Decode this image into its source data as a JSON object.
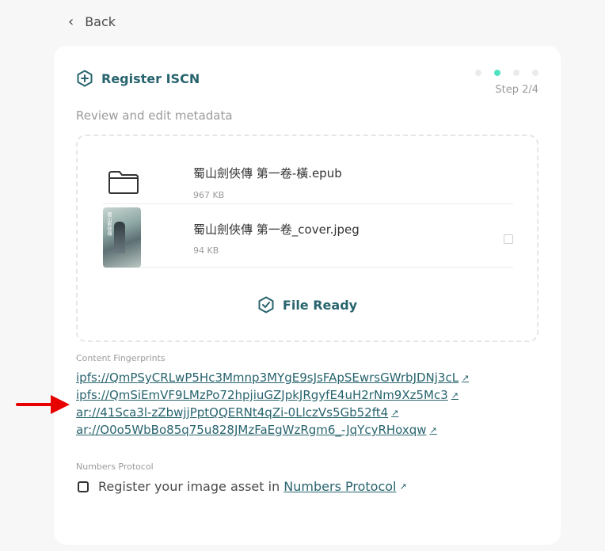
{
  "nav": {
    "back_label": "Back"
  },
  "header": {
    "title": "Register ISCN",
    "step_label": "Step 2/4",
    "steps_total": 4,
    "step_current": 2
  },
  "subtitle": "Review and edit metadata",
  "files": [
    {
      "name": "蜀山劍俠傳 第一卷-橫.epub",
      "size": "967 KB",
      "icon": "folder-icon"
    },
    {
      "name": "蜀山劍俠傳 第一卷_cover.jpeg",
      "size": "94 KB",
      "icon": "image-thumbnail"
    }
  ],
  "file_ready_label": "File Ready",
  "fingerprints": {
    "label": "Content Fingerprints",
    "links": [
      "ipfs://QmPSyCRLwP5Hc3Mmnp3MYgE9sJsFApSEwrsGWrbJDNj3cL",
      "ipfs://QmSiEmVF9LMzPo72hpjiuGZJpkJRgyfE4uH2rNm9Xz5Mc3",
      "ar://41Sca3l-zZbwjjPptQQERNt4qZi-0LlczVs5Gb52ft4",
      "ar://O0o5WbBo85q75u828JMzFaEgWzRgm6_-JqYcyRHoxqw"
    ]
  },
  "numbers_protocol": {
    "label": "Numbers Protocol",
    "checkbox_text": "Register your image asset in ",
    "link_text": "Numbers Protocol"
  },
  "colors": {
    "accent": "#28646e",
    "active_dot": "#50e3c2",
    "arrow": "#e60000"
  }
}
